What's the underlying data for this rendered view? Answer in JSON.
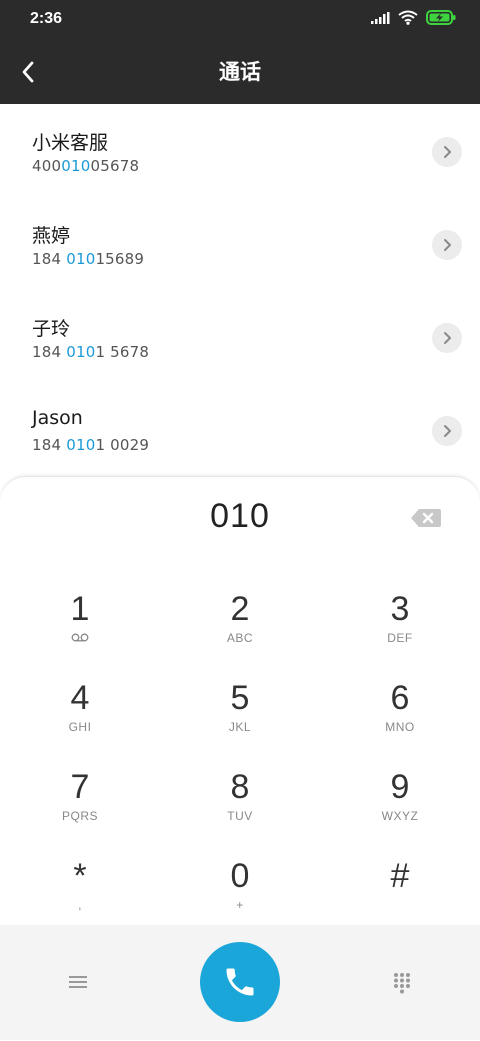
{
  "status": {
    "time": "2:36"
  },
  "header": {
    "title": "通话"
  },
  "contacts": [
    {
      "name": "小米客服",
      "num_pre": "400",
      "num_hl": "010",
      "num_post": "05678"
    },
    {
      "name": "燕婷",
      "num_pre": "184 ",
      "num_hl": "010",
      "num_post": "15689"
    },
    {
      "name": "子玲",
      "num_pre": "184 ",
      "num_hl": "010",
      "num_post": "1 5678"
    },
    {
      "name": "Jason",
      "num_pre": "184 ",
      "num_hl": "010",
      "num_post": "1 0029"
    }
  ],
  "dialpad": {
    "input": "010",
    "keys": [
      {
        "digit": "1",
        "letters": ""
      },
      {
        "digit": "2",
        "letters": "ABC"
      },
      {
        "digit": "3",
        "letters": "DEF"
      },
      {
        "digit": "4",
        "letters": "GHI"
      },
      {
        "digit": "5",
        "letters": "JKL"
      },
      {
        "digit": "6",
        "letters": "MNO"
      },
      {
        "digit": "7",
        "letters": "PQRS"
      },
      {
        "digit": "8",
        "letters": "TUV"
      },
      {
        "digit": "9",
        "letters": "WXYZ"
      },
      {
        "digit": "*",
        "letters": ","
      },
      {
        "digit": "0",
        "letters": "+"
      },
      {
        "digit": "#",
        "letters": ""
      }
    ]
  },
  "icons": {
    "back": "chevron-left-icon",
    "voicemail": "voicemail-icon",
    "backspace": "backspace-icon",
    "call": "phone-icon",
    "menu": "menu-icon",
    "dialpad": "dialpad-grid-icon"
  },
  "colors": {
    "accent": "#1a9ad8",
    "call_button": "#1aa6d8",
    "header_bg": "#2b2b2b"
  }
}
